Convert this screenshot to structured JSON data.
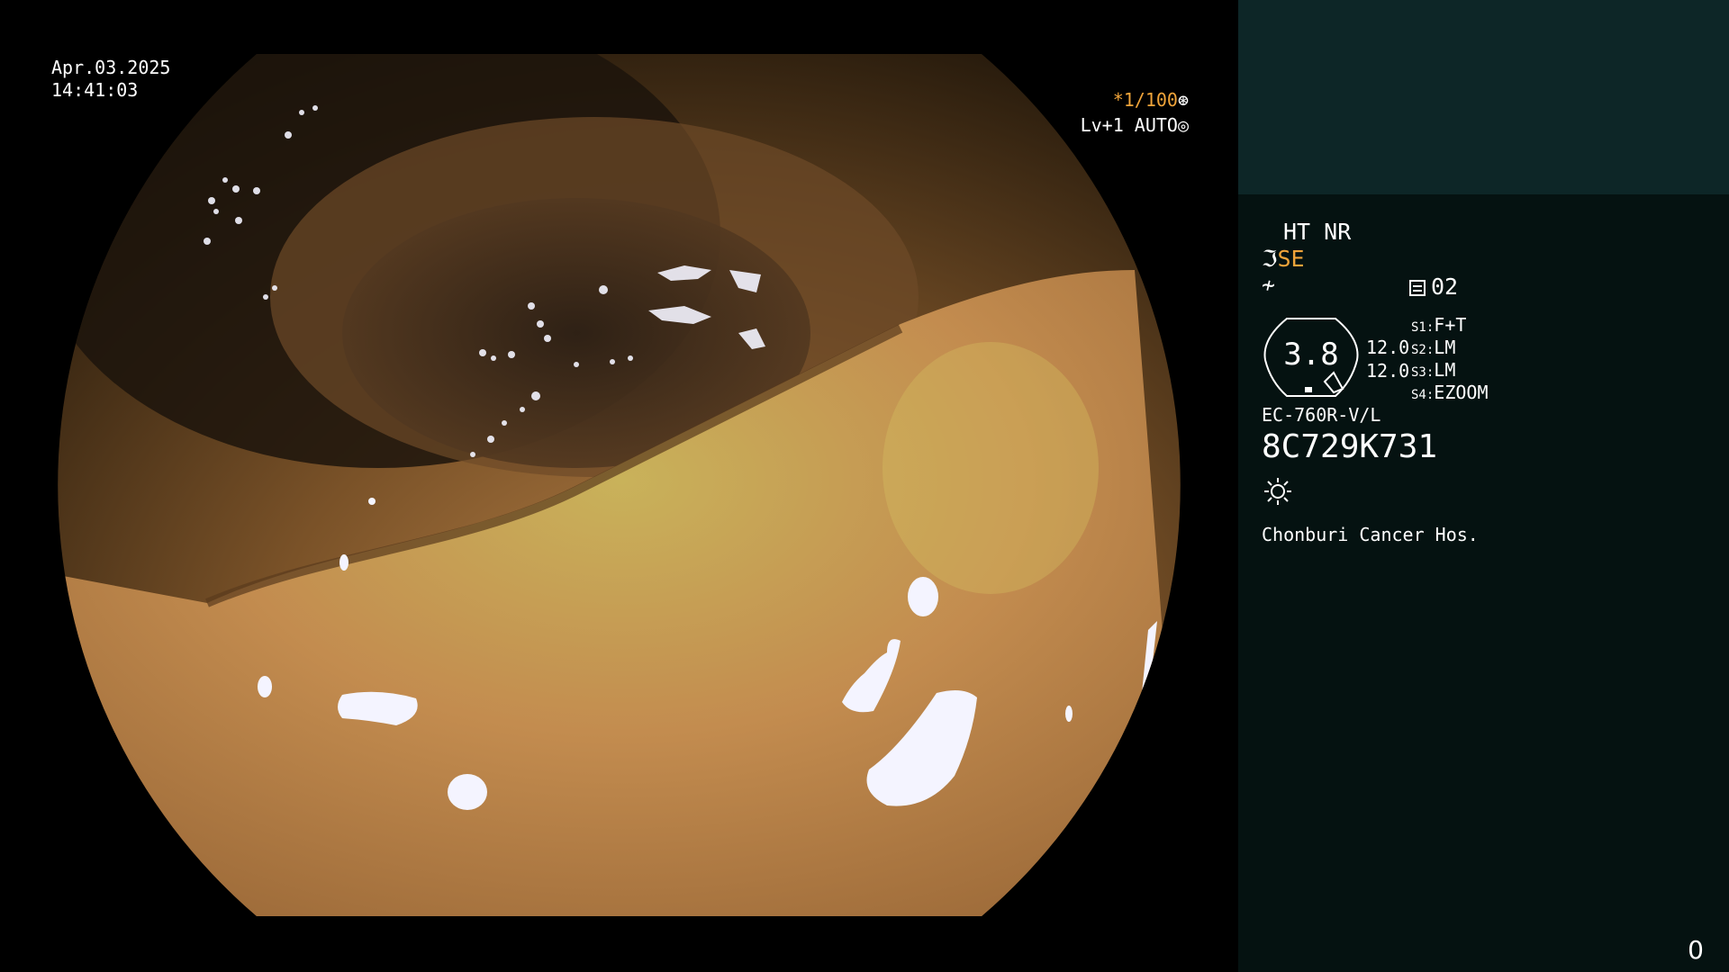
{
  "image_info": {
    "date": "Apr.03.2025",
    "time": "14:41:03",
    "shutter": {
      "prefix": "*1/100",
      "icon": "shutter-icon"
    },
    "level": {
      "text": "Lv+1 AUTO",
      "icon": "iris-icon"
    }
  },
  "panel": {
    "ht_nr": "HT NR",
    "se_label": "SE",
    "se_icon": "structure-enhancement-icon",
    "enhancement_icon": "enhancement-slash-icon",
    "memo_label": "02",
    "memo_icon": "memo-icon",
    "zoom_value": "3.8",
    "frame_rates": [
      "12.0",
      "12.0"
    ],
    "switches": [
      {
        "key": "S1:",
        "value": "F+T"
      },
      {
        "key": "S2:",
        "value": "LM"
      },
      {
        "key": "S3:",
        "value": "LM"
      },
      {
        "key": "S4:",
        "value": "EZOOM"
      }
    ],
    "scope_model": "EC-760R-V/L",
    "serial_number": "8C729K731",
    "light_icon": "light-sun-icon",
    "hospital": "Chonburi Cancer Hos.",
    "counter": "0"
  },
  "colors": {
    "accent_orange": "#f0a43a",
    "panel_bg": "#051211",
    "panel_top_bg": "#0d2627",
    "mucosa": "#c98f4e"
  }
}
